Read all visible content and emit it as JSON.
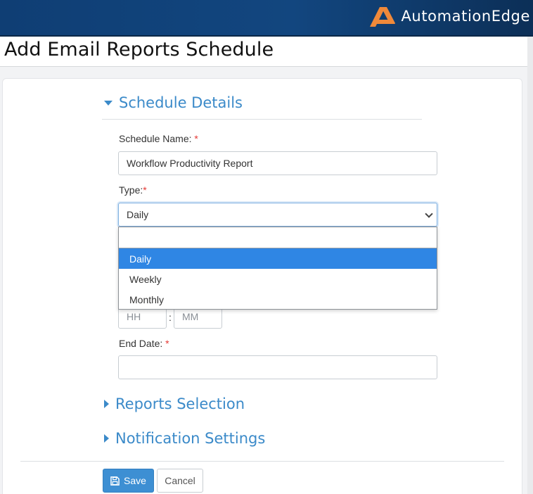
{
  "brand": {
    "name": "AutomationEdge",
    "accent_color": "#f0893a"
  },
  "page": {
    "title": "Add Email Reports Schedule"
  },
  "sections": [
    {
      "label": "Schedule Details",
      "expanded": true
    },
    {
      "label": "Reports Selection",
      "expanded": false
    },
    {
      "label": "Notification Settings",
      "expanded": false
    }
  ],
  "form": {
    "schedule_name": {
      "label": "Schedule Name:",
      "required_mark": "*",
      "value": "Workflow Productivity Report"
    },
    "type": {
      "label": "Type:",
      "required_mark": "*",
      "selected": "Daily",
      "options": [
        "Daily",
        "Weekly",
        "Monthly"
      ]
    },
    "time": {
      "hour_placeholder": "HH",
      "separator": ":",
      "minute_placeholder": "MM"
    },
    "end_date": {
      "label": "End Date:",
      "required_mark": "*",
      "value": ""
    }
  },
  "actions": {
    "save_label": "Save",
    "cancel_label": "Cancel",
    "save_icon": "floppy-disk-icon"
  },
  "colors": {
    "header_bg": "#12467f",
    "link_blue": "#3b8ac9",
    "selected_option": "#2f86e4",
    "primary_button": "#3d8fd3"
  }
}
